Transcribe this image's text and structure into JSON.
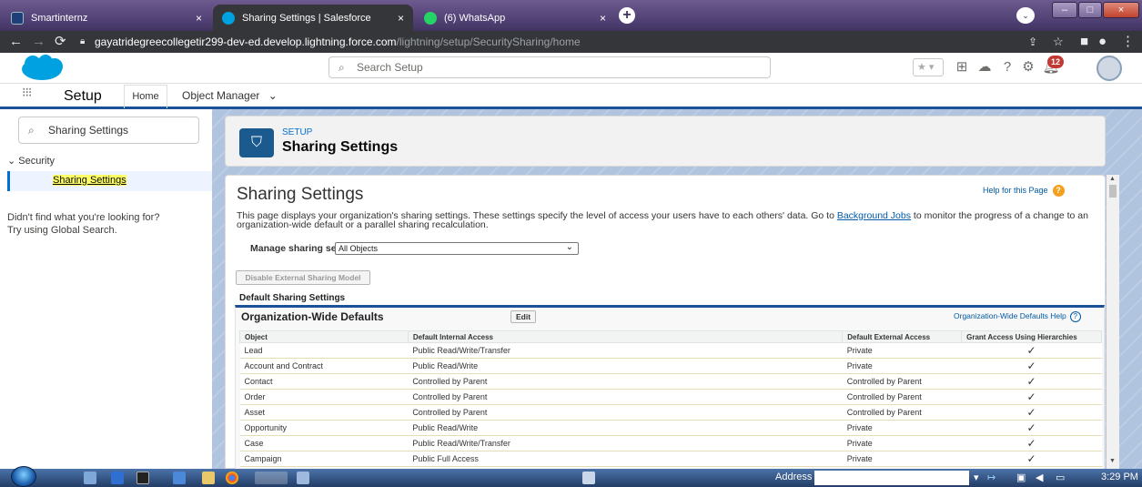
{
  "browser": {
    "tabs": [
      {
        "label": "Smartinternz",
        "active": false
      },
      {
        "label": "Sharing Settings | Salesforce",
        "active": true
      },
      {
        "label": "(6) WhatsApp",
        "active": false
      }
    ],
    "tab_close": "×",
    "new_tab": "+",
    "url_host": "gayatridegreecollegetir299-dev-ed.develop.lightning.force.com",
    "url_path": "/lightning/setup/SecuritySharing/home",
    "window_buttons": [
      "–",
      "□",
      "×"
    ]
  },
  "sf_header": {
    "search_placeholder": "Search Setup",
    "notification_count": "12"
  },
  "app_nav": {
    "app_name": "Setup",
    "tabs": [
      {
        "label": "Home"
      },
      {
        "label": "Object Manager"
      }
    ]
  },
  "left_pane": {
    "quick_find_value": "Sharing Settings",
    "tree_section": "Security",
    "tree_item": "Sharing Settings",
    "no_result_line1": "Didn't find what you're looking for?",
    "no_result_line2": "Try using Global Search."
  },
  "page_header": {
    "eyebrow": "SETUP",
    "title": "Sharing Settings"
  },
  "content": {
    "heading": "Sharing Settings",
    "help_link": "Help for this Page",
    "desc_before_link": "This page displays your organization's sharing settings. These settings specify the level of access your users have to each others' data. Go to ",
    "desc_link": "Background Jobs",
    "desc_after_link": " to monitor the progress of a change to an organization-wide default or a parallel sharing recalculation.",
    "manage_label": "Manage sharing settings for:",
    "manage_value": "All Objects",
    "disable_button": "Disable External Sharing Model",
    "default_sharing_heading": "Default Sharing Settings"
  },
  "owd": {
    "title": "Organization-Wide Defaults",
    "edit_button": "Edit",
    "help_link": "Organization-Wide Defaults Help",
    "columns": [
      "Object",
      "Default Internal Access",
      "Default External Access",
      "Grant Access Using Hierarchies"
    ],
    "rows": [
      [
        "Lead",
        "Public Read/Write/Transfer",
        "Private",
        "✓"
      ],
      [
        "Account and Contract",
        "Public Read/Write",
        "Private",
        "✓"
      ],
      [
        "Contact",
        "Controlled by Parent",
        "Controlled by Parent",
        "✓"
      ],
      [
        "Order",
        "Controlled by Parent",
        "Controlled by Parent",
        "✓"
      ],
      [
        "Asset",
        "Controlled by Parent",
        "Controlled by Parent",
        "✓"
      ],
      [
        "Opportunity",
        "Public Read/Write",
        "Private",
        "✓"
      ],
      [
        "Case",
        "Public Read/Write/Transfer",
        "Private",
        "✓"
      ],
      [
        "Campaign",
        "Public Full Access",
        "Private",
        "✓"
      ]
    ]
  },
  "taskbar": {
    "address_label": "Address",
    "clock": "3:29 PM"
  },
  "colors": {
    "salesforce_blue": "#00a1e0",
    "nav_accent": "#1b5297",
    "link": "#015ba7",
    "highlight": "#ffff66"
  }
}
